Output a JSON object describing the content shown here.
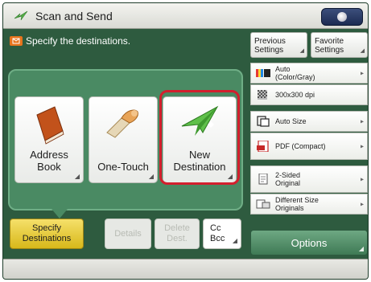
{
  "window": {
    "title": "Scan and Send"
  },
  "banner": {
    "text": "Specify the destinations."
  },
  "destinations": {
    "address_book": "Address\nBook",
    "one_touch": "One-Touch",
    "new_destination": "New\nDestination"
  },
  "tabs": {
    "specify": "Specify\nDestinations",
    "details": "Details",
    "delete": "Delete\nDest.",
    "cc_bcc": "Cc\nBcc"
  },
  "right": {
    "previous": "Previous\nSettings",
    "favorite": "Favorite\nSettings",
    "settings": [
      {
        "icon": "color-mode-icon",
        "label": "Auto\n(Color/Gray)"
      },
      {
        "icon": "resolution-icon",
        "label": "300x300 dpi"
      },
      {
        "icon": "scan-size-icon",
        "label": "Auto Size"
      },
      {
        "icon": "pdf-icon",
        "label": "PDF (Compact)"
      },
      {
        "icon": "two-sided-icon",
        "label": "2-Sided\nOriginal"
      },
      {
        "icon": "different-size-icon",
        "label": "Different Size\nOriginals"
      }
    ],
    "options": "Options"
  },
  "colors": {
    "accent_green": "#2e5b3f",
    "specify_yellow": "#e4c534",
    "highlight_red": "#d31f2d"
  }
}
